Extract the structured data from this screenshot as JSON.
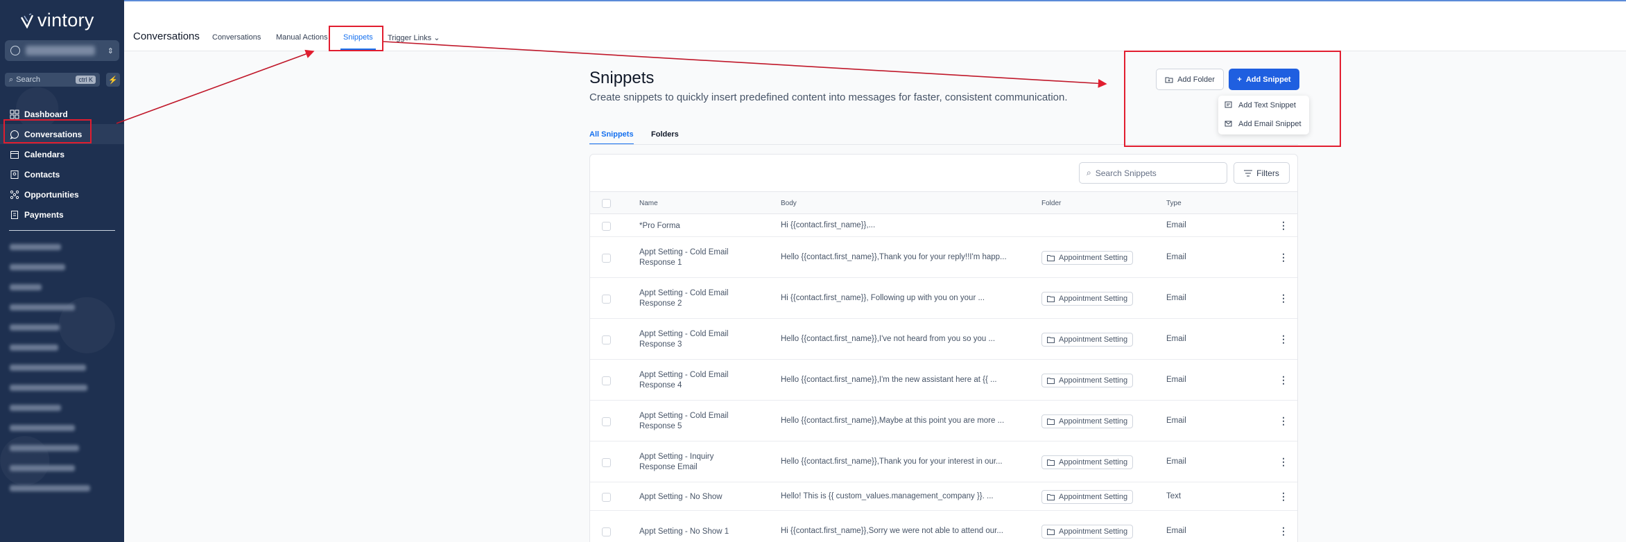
{
  "app": {
    "logo_text": "vintory"
  },
  "sidebar": {
    "search_placeholder": "Search",
    "search_shortcut": "ctrl K",
    "nav": [
      {
        "label": "Dashboard",
        "icon": "dashboard-icon"
      },
      {
        "label": "Conversations",
        "icon": "chat-icon"
      },
      {
        "label": "Calendars",
        "icon": "calendar-icon"
      },
      {
        "label": "Contacts",
        "icon": "contacts-icon"
      },
      {
        "label": "Opportunities",
        "icon": "opportunities-icon"
      },
      {
        "label": "Payments",
        "icon": "payments-icon"
      }
    ]
  },
  "topbar": {
    "title": "Conversations",
    "tabs": [
      "Conversations",
      "Manual Actions",
      "Snippets",
      "Trigger Links"
    ]
  },
  "main": {
    "title": "Snippets",
    "subtitle": "Create snippets to quickly insert predefined content into messages for faster, consistent communication.",
    "subtabs": [
      "All Snippets",
      "Folders"
    ],
    "add_folder": "Add Folder",
    "add_snippet": "Add Snippet",
    "dropdown": [
      "Add Text Snippet",
      "Add Email Snippet"
    ],
    "search_placeholder": "Search Snippets",
    "filters": "Filters",
    "columns": [
      "Name",
      "Body",
      "Folder",
      "Type"
    ],
    "rows": [
      {
        "name": "*Pro Forma",
        "body": "Hi {{contact.first_name}},...",
        "folder": "",
        "type": "Email"
      },
      {
        "name": "Appt Setting - Cold Email Response 1",
        "body": "Hello {{contact.first_name}},Thank you for your reply!!I'm happ...",
        "folder": "Appointment Setting",
        "type": "Email"
      },
      {
        "name": "Appt Setting - Cold Email Response 2",
        "body": "Hi {{contact.first_name}}, Following up with you on your ...",
        "folder": "Appointment Setting",
        "type": "Email"
      },
      {
        "name": "Appt Setting - Cold Email Response 3",
        "body": "Hello {{contact.first_name}},I've not heard from you so you ...",
        "folder": "Appointment Setting",
        "type": "Email"
      },
      {
        "name": "Appt Setting - Cold Email Response 4",
        "body": "Hello {{contact.first_name}},I'm the new assistant here at {{ ...",
        "folder": "Appointment Setting",
        "type": "Email"
      },
      {
        "name": "Appt Setting - Cold Email Response 5",
        "body": "Hello {{contact.first_name}},Maybe at this point you are more ...",
        "folder": "Appointment Setting",
        "type": "Email"
      },
      {
        "name": "Appt Setting - Inquiry Response Email",
        "body": "Hello {{contact.first_name}},Thank you for your interest in our...",
        "folder": "Appointment Setting",
        "type": "Email"
      },
      {
        "name": "Appt Setting - No Show",
        "body": "Hello! This is {{ custom_values.management_company }}.  ...",
        "folder": "Appointment Setting",
        "type": "Text"
      },
      {
        "name": "Appt Setting - No Show 1",
        "body": "Hi {{contact.first_name}},Sorry we were not able to attend our...",
        "folder": "Appointment Setting",
        "type": "Email"
      }
    ]
  },
  "colors": {
    "accent": "#1570ef",
    "sidebar": "#1e3050",
    "annotation": "#e11d2f"
  }
}
